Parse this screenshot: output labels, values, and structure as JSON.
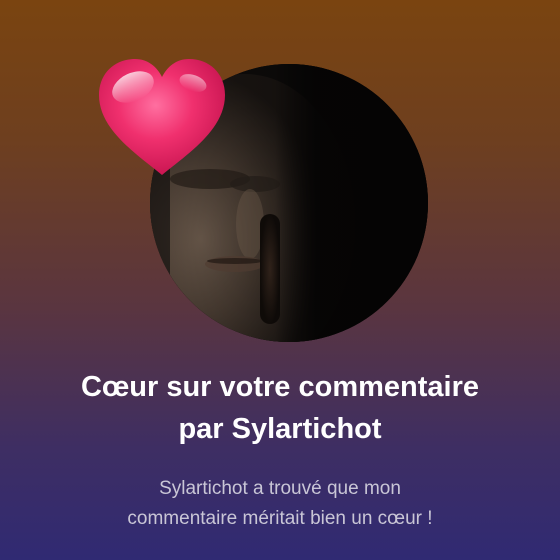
{
  "notification": {
    "title_line1": "Cœur sur votre commentaire",
    "title_line2": "par Sylartichot",
    "message_line1": "Sylartichot a trouvé que mon",
    "message_line2": "commentaire méritait bien un cœur !"
  },
  "icons": {
    "heart": "heart-icon"
  },
  "colors": {
    "gradient_top": "#7a4410",
    "gradient_bottom": "#302a73",
    "title": "#ffffff",
    "message": "#c9c6d6",
    "heart": "#f0306e"
  }
}
